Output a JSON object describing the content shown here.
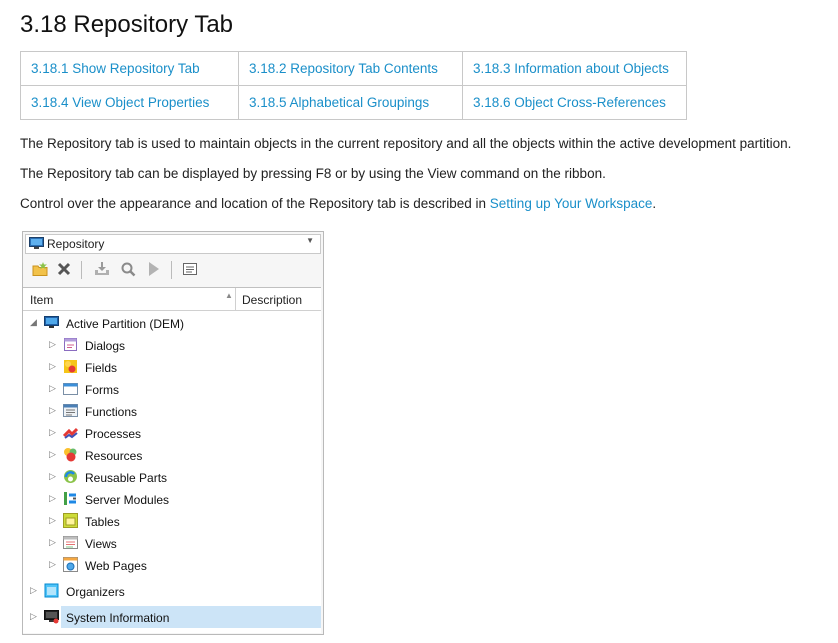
{
  "page": {
    "title": "3.18 Repository Tab",
    "links": [
      [
        "3.18.1 Show Repository Tab",
        "3.18.2 Repository Tab Contents",
        "3.18.3 Information about Objects"
      ],
      [
        "3.18.4 View Object Properties",
        "3.18.5 Alphabetical Groupings",
        "3.18.6 Object Cross-References"
      ]
    ],
    "para1": "The Repository tab is used to maintain objects in the current repository and all the objects within the active development partition.",
    "para2": "The Repository tab can be displayed by pressing F8 or by using the View command on the ribbon.",
    "para3_prefix": "Control over the appearance and location of the Repository tab is described in ",
    "para3_link": "Setting up Your Workspace",
    "para3_suffix": "."
  },
  "panel": {
    "selector_label": "Repository",
    "toolbar_icons": [
      "new-folder-icon",
      "delete-icon",
      "import-icon",
      "search-icon",
      "run-icon",
      "properties-icon"
    ],
    "column_item": "Item",
    "column_description": "Description",
    "root": "Active Partition (DEM)",
    "children": [
      "Dialogs",
      "Fields",
      "Forms",
      "Functions",
      "Processes",
      "Resources",
      "Reusable Parts",
      "Server Modules",
      "Tables",
      "Views",
      "Web Pages"
    ],
    "organizers": "Organizers",
    "system_information": "System Information"
  },
  "colors": {
    "link": "#1a8fc9",
    "selection": "#cce4f7"
  }
}
